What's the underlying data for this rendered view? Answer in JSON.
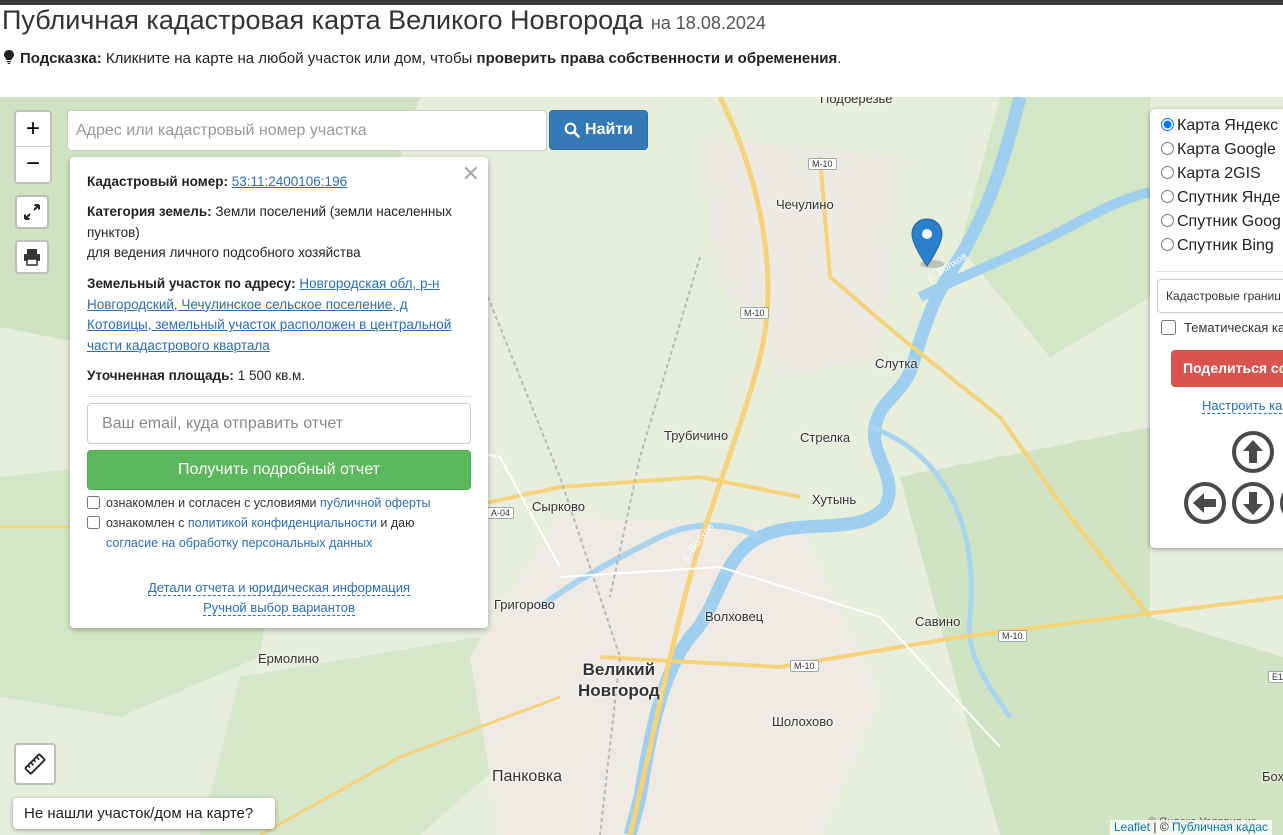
{
  "header": {
    "title": "Публичная кадастровая карта Великого Новгорода",
    "date": "на 18.08.2024",
    "hint_label": "Подсказка:",
    "hint_text": " Кликните на карте на любой участок или дом, чтобы ",
    "hint_bold": "проверить права собственности и обременения",
    "hint_end": "."
  },
  "search": {
    "placeholder": "Адрес или кадастровый номер участка",
    "button_label": "Найти"
  },
  "zoom": {
    "in": "+",
    "out": "−"
  },
  "popup": {
    "cadastral_label": "Кадастровый номер:",
    "cadastral_number": "53:11:2400106:196",
    "category_label": "Категория земель:",
    "category_value": "Земли поселений (земли населенных пунктов)",
    "usage": "для ведения личного подсобного хозяйства",
    "address_label": "Земельный участок по адресу:",
    "address_value": "Новгородская обл, р-н Новгородский, Чечулинское сельское поселение, д Котовицы, земельный участок расположен в центральной части кадастрового квартала",
    "area_label": "Уточненная площадь:",
    "area_value": "1 500 кв.м.",
    "email_placeholder": "Ваш email, куда отправить отчет",
    "report_button": "Получить подробный отчет",
    "agree1_text": "ознакомлен и согласен с условиями ",
    "agree1_link": "публичной оферты",
    "agree2_text": "ознакомлен с ",
    "agree2_link": "политикой конфиденциальности",
    "agree2_text2": " и даю",
    "agree2_link2": "согласие на обработку персональных данных",
    "details_link": "Детали отчета и юридическая информация",
    "manual_link": "Ручной выбор вариантов"
  },
  "layers": {
    "options": [
      "Карта Яндекс",
      "Карта Google",
      "Карта 2GIS",
      "Спутник Янде",
      "Спутник Goog",
      "Спутник Bing"
    ],
    "selected": 0,
    "cadastral_select": "Кадастровые границы",
    "thematic_label": "Тематическая ка",
    "share_button": "Поделиться сс",
    "setup_link": "Настроить ка"
  },
  "map": {
    "places": {
      "podberezye": "Подберезье",
      "chechulino": "Чечулино",
      "slutka": "Слутка",
      "trubichino": "Трубичино",
      "strelka": "Стрелка",
      "syrkovo": "Сырково",
      "khutyn": "Хутынь",
      "grigorovo": "Григорово",
      "volkhovets": "Волховец",
      "savino": "Савино",
      "ermolino": "Ермолино",
      "novgorod": "Великий\nНовгород",
      "sholokhovo": "Шолохово",
      "pankovka": "Панковка",
      "bokh": "Бох"
    },
    "roads": {
      "m10": "М-10",
      "a04": "А-04",
      "e1": "Е1"
    },
    "river": "р. Волхов"
  },
  "footer": {
    "not_found": "Не нашли участок/дом на карте?",
    "leaflet": "Leaflet",
    "separator": " | © ",
    "attribution": "Публичная кадас",
    "yandex": "© Яндекс  Условия ис"
  },
  "colors": {
    "primary": "#337ab7",
    "success": "#5cb85c",
    "danger": "#d9534f",
    "link": "#2a6eb5",
    "marker": "#2a81cb"
  }
}
